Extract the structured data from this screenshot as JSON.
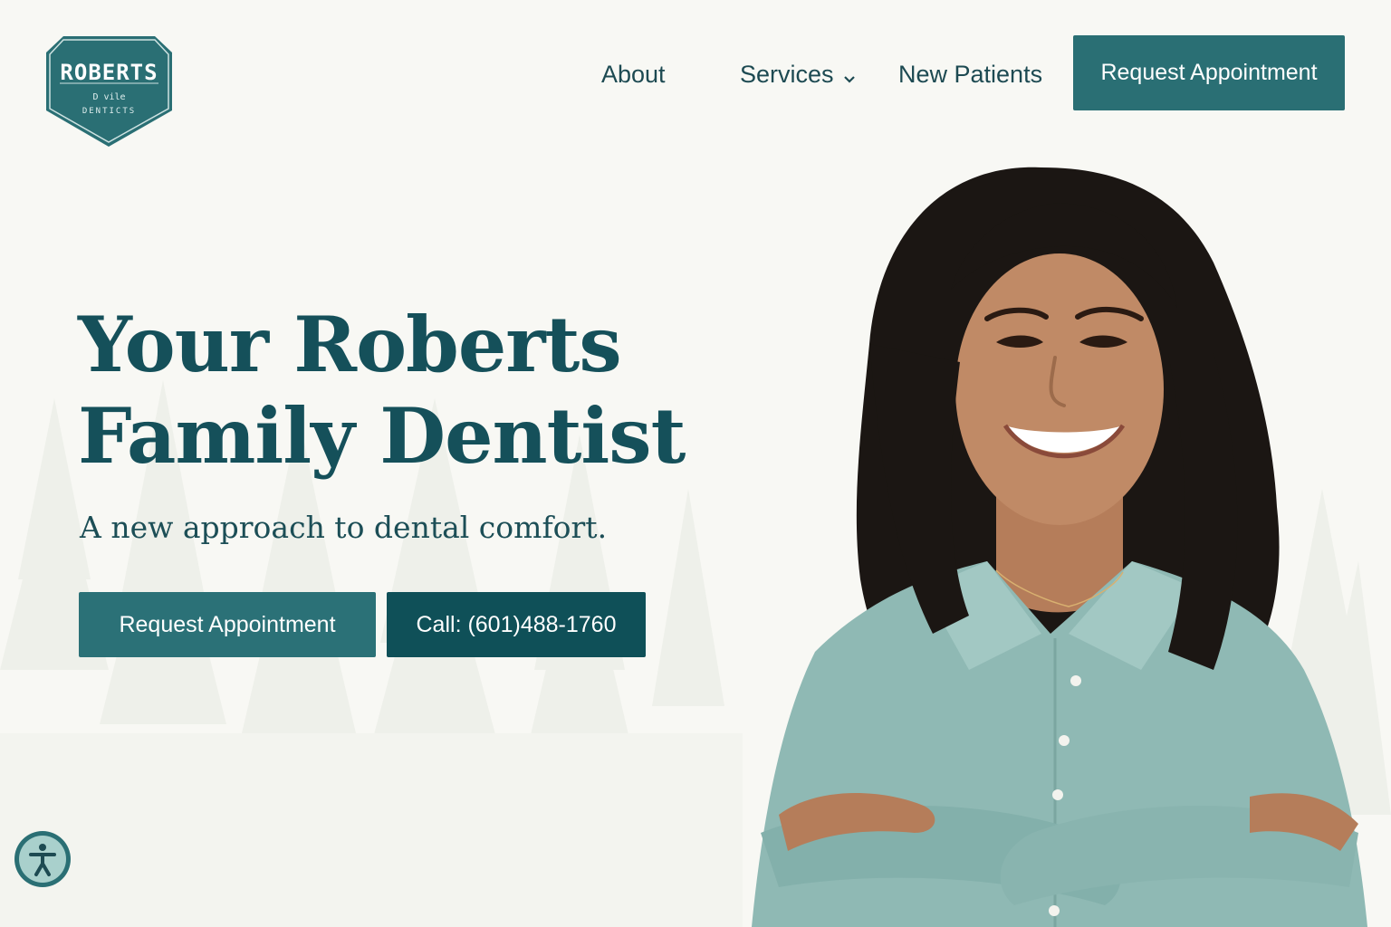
{
  "logo": {
    "title": "ROBERTS",
    "line2": "D vile",
    "line3": "DENTICTS"
  },
  "nav": {
    "about": "About",
    "services": "Services",
    "new_patients": "New Patients",
    "cta": "Request Appointment"
  },
  "hero": {
    "title_line1": "Your Roberts",
    "title_line2": "Family Dentist",
    "subtitle": "A new approach to dental comfort.",
    "request_button": "Request Appointment",
    "call_button": "Call: (601)488-1760"
  },
  "icons": {
    "services_dropdown": "chevron-down-icon",
    "accessibility": "accessibility-icon"
  },
  "colors": {
    "brand_teal": "#2a6f74",
    "dark_teal": "#0f5058",
    "heading": "#15505a",
    "background": "#f8f8f4",
    "shirt": "#8fb9b4"
  }
}
